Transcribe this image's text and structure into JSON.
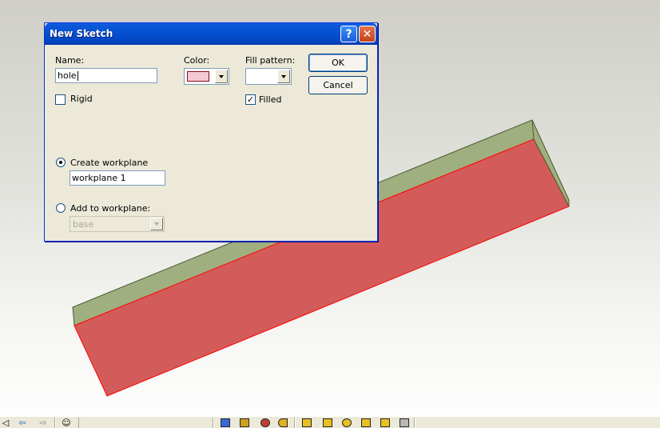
{
  "dialog": {
    "title": "New Sketch",
    "name_label": "Name:",
    "name_value": "hole",
    "color_label": "Color:",
    "color_value": "#f3c9d3",
    "fill_pattern_label": "Fill pattern:",
    "rigid_label": "Rigid",
    "rigid_checked": false,
    "filled_label": "Filled",
    "filled_checked": true,
    "create_workplane_label": "Create workplane",
    "create_workplane_selected": true,
    "workplane_name_value": "workplane 1",
    "add_to_workplane_label": "Add to workplane:",
    "add_to_workplane_selected": false,
    "workplane_select_value": "base",
    "ok_label": "OK",
    "cancel_label": "Cancel",
    "help_glyph": "?",
    "close_glyph": "✕"
  },
  "viewport": {
    "box_top_color": "#9faf7f",
    "box_side_color": "#d35c5a",
    "box_edge_color": "#ff0000"
  },
  "toolbar": {
    "icons": [
      "select-icon",
      "back-arrow-icon",
      "forward-arrow-icon",
      "smiley-icon",
      "shape-tool-icon",
      "shape-tool-icon",
      "shape-tool-icon",
      "shape-tool-icon",
      "part-tool-icon",
      "part-tool-icon",
      "part-tool-icon",
      "part-tool-icon",
      "part-tool-icon",
      "part-tool-icon"
    ]
  }
}
